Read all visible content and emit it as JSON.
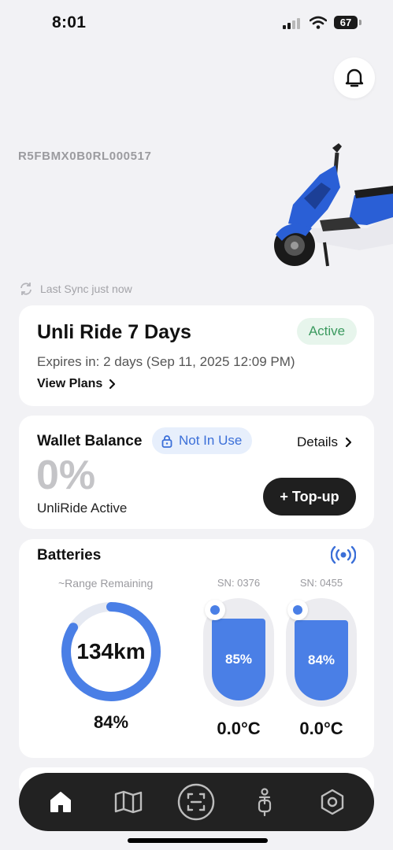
{
  "status_bar": {
    "time": "8:01",
    "battery_level": "67"
  },
  "vehicle": {
    "id": "R5FBMX0B0RL000517",
    "image": "blue-electric-scooter"
  },
  "sync": {
    "text": "Last Sync just now",
    "icon": "sync-icon"
  },
  "plan": {
    "title": "Unli Ride 7 Days",
    "status": "Active",
    "expires": "Expires in: 2 days (Sep 11, 2025 12:09 PM)",
    "view_plans_label": "View Plans"
  },
  "wallet": {
    "title": "Wallet Balance",
    "badge": "Not In Use",
    "details_label": "Details",
    "balance": "0%",
    "status": "UnliRide Active",
    "topup_label": "+ Top-up"
  },
  "batteries": {
    "title": "Batteries",
    "range_label": "~Range Remaining",
    "range_value": "134km",
    "range_percent_value": 84,
    "overall_percent": "84%",
    "packs": [
      {
        "sn": "SN: 0376",
        "percent": "85%",
        "level": 85,
        "temperature": "0.0°C"
      },
      {
        "sn": "SN: 0455",
        "percent": "84%",
        "level": 84,
        "temperature": "0.0°C"
      }
    ]
  },
  "nav": {
    "items": [
      {
        "name": "home",
        "icon": "home-icon",
        "active": true
      },
      {
        "name": "map",
        "icon": "map-icon"
      },
      {
        "name": "scan",
        "icon": "scan-icon"
      },
      {
        "name": "ride",
        "icon": "scooter-rider-icon"
      },
      {
        "name": "settings",
        "icon": "hexagon-settings-icon"
      }
    ]
  },
  "colors": {
    "accent": "#4a7fe6",
    "active_green": "#3b9a5f",
    "active_bg": "#e7f5ec",
    "navbar": "#222222",
    "background": "#f2f2f5"
  }
}
